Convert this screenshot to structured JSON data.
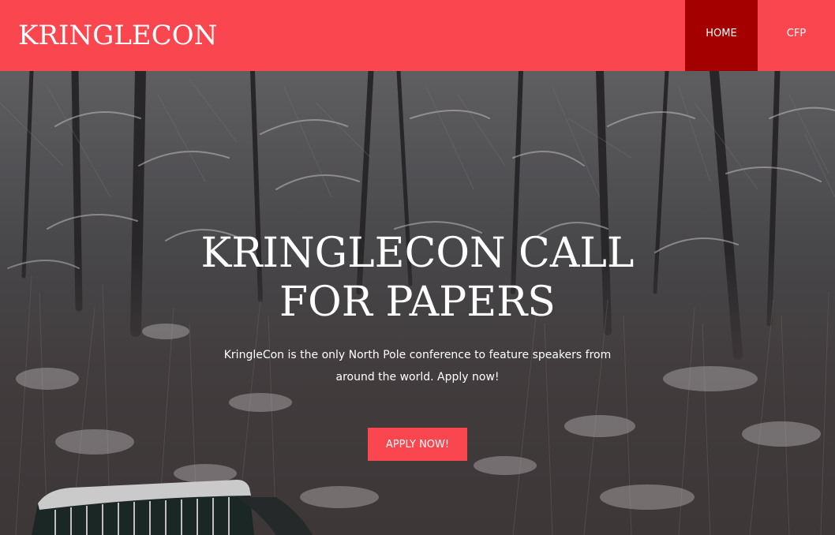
{
  "header": {
    "logo": "KRINGLECON",
    "nav": [
      {
        "label": "HOME",
        "active": true
      },
      {
        "label": "CFP",
        "active": false
      }
    ]
  },
  "hero": {
    "title": "KRINGLECON CALL FOR PAPERS",
    "subtitle": "KringleCon is the only North Pole conference to feature speakers from around the world. Apply now!",
    "cta_label": "APPLY NOW!",
    "background": "snowy-forest-bench-photo"
  },
  "colors": {
    "brand": "#f9464f",
    "nav_active": "#a50000",
    "text_on_dark": "#ffffff"
  }
}
